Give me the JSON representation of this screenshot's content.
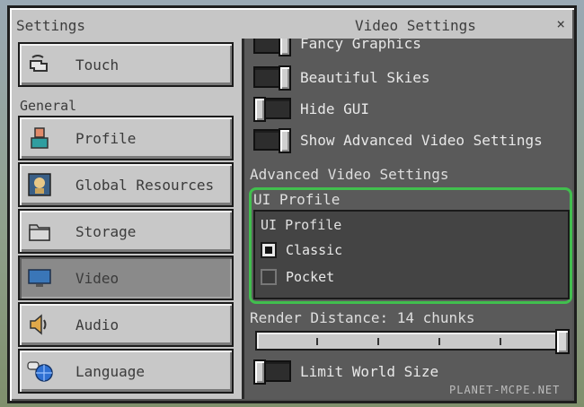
{
  "titles": {
    "left": "Settings",
    "right": "Video Settings",
    "close": "×"
  },
  "sidebar": {
    "touch": {
      "label": "Touch"
    },
    "section_general": "General",
    "items": [
      {
        "label": "Profile"
      },
      {
        "label": "Global Resources"
      },
      {
        "label": "Storage"
      },
      {
        "label": "Video",
        "selected": true
      },
      {
        "label": "Audio"
      },
      {
        "label": "Language"
      }
    ]
  },
  "content": {
    "toggles": [
      {
        "label": "Fancy Graphics",
        "state": "on"
      },
      {
        "label": "Beautiful Skies",
        "state": "on"
      },
      {
        "label": "Hide GUI",
        "state": "off"
      },
      {
        "label": "Show Advanced Video Settings",
        "state": "on"
      }
    ],
    "advanced_heading": "Advanced Video Settings",
    "ui_profile": {
      "label": "UI Profile",
      "dropdown_title": "UI Profile",
      "options": [
        {
          "label": "Classic",
          "selected": true
        },
        {
          "label": "Pocket",
          "selected": false
        }
      ]
    },
    "render_distance": {
      "label": "Render Distance: 14 chunks",
      "value": 14
    },
    "limit_world": {
      "label": "Limit World Size",
      "state": "off"
    }
  },
  "watermark": "PLANET-MCPE.NET",
  "colors": {
    "highlight": "#41bf4e",
    "panel": "#5a5a5a",
    "window": "#c6c6c6"
  }
}
